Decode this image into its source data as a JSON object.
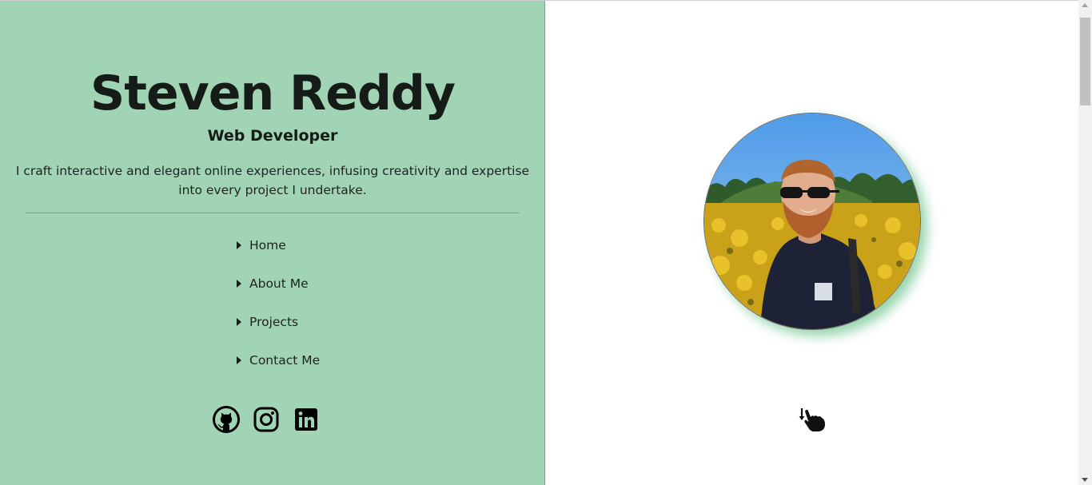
{
  "hero": {
    "name": "Steven Reddy",
    "role": "Web Developer",
    "intro": "I craft interactive and elegant online experiences, infusing creativity and expertise into every project I undertake."
  },
  "nav": {
    "items": [
      {
        "label": "Home"
      },
      {
        "label": "About Me"
      },
      {
        "label": "Projects"
      },
      {
        "label": "Contact Me"
      }
    ]
  },
  "socials": {
    "icons": [
      "github-icon",
      "instagram-icon",
      "linkedin-icon"
    ]
  },
  "profile": {
    "image_alt": "profile-photo",
    "scroll_hint_icon": "swipe-down-icon"
  },
  "colors": {
    "left_panel_bg": "#a1d4b4",
    "text_dark": "#151b17",
    "photo_shadow": "#78c896"
  }
}
